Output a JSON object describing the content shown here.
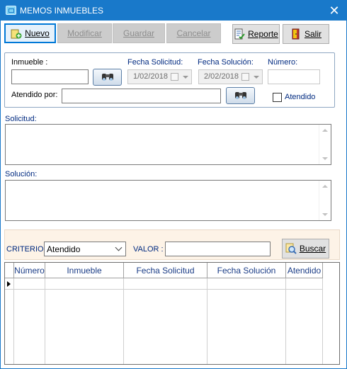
{
  "window": {
    "title": "MEMOS INMUEBLES"
  },
  "colors": {
    "titlebar": "#1979ca",
    "label": "#002a80",
    "grid_header": "#1a3c86",
    "search_panel": "#fdf3e7"
  },
  "toolbar": {
    "nuevo": "Nuevo",
    "modificar": "Modificar",
    "guardar": "Guardar",
    "cancelar": "Cancelar",
    "reporte": "Reporte",
    "salir": "Salir"
  },
  "form": {
    "inmueble_label": "Inmueble :",
    "inmueble_value": "",
    "fecha_solicitud_label": "Fecha Solicitud:",
    "fecha_solicitud_value": "1/02/2018",
    "fecha_solucion_label": "Fecha Solución:",
    "fecha_solucion_value": "2/02/2018",
    "numero_label": "Número:",
    "numero_value": "",
    "atendido_por_label": "Atendido por:",
    "atendido_por_value": "",
    "atendido_checkbox_label": "Atendido",
    "atendido_checked": false,
    "solicitud_label": "Solicitud:",
    "solicitud_value": "",
    "solucion_label": "Solución:",
    "solucion_value": ""
  },
  "search": {
    "criterio_label": "CRITERIO:",
    "criterio_selected": "Atendido",
    "valor_label": "VALOR :",
    "valor_value": "",
    "buscar": "Buscar"
  },
  "grid": {
    "columns": [
      "Número",
      "Inmueble",
      "Fecha Solicitud",
      "Fecha Solución",
      "Atendido"
    ],
    "rows": []
  },
  "icons": {
    "nuevo": "add-icon",
    "reporte": "report-icon",
    "salir": "exit-door-icon",
    "search": "binoculars-icon",
    "buscar": "magnifier-icon"
  }
}
